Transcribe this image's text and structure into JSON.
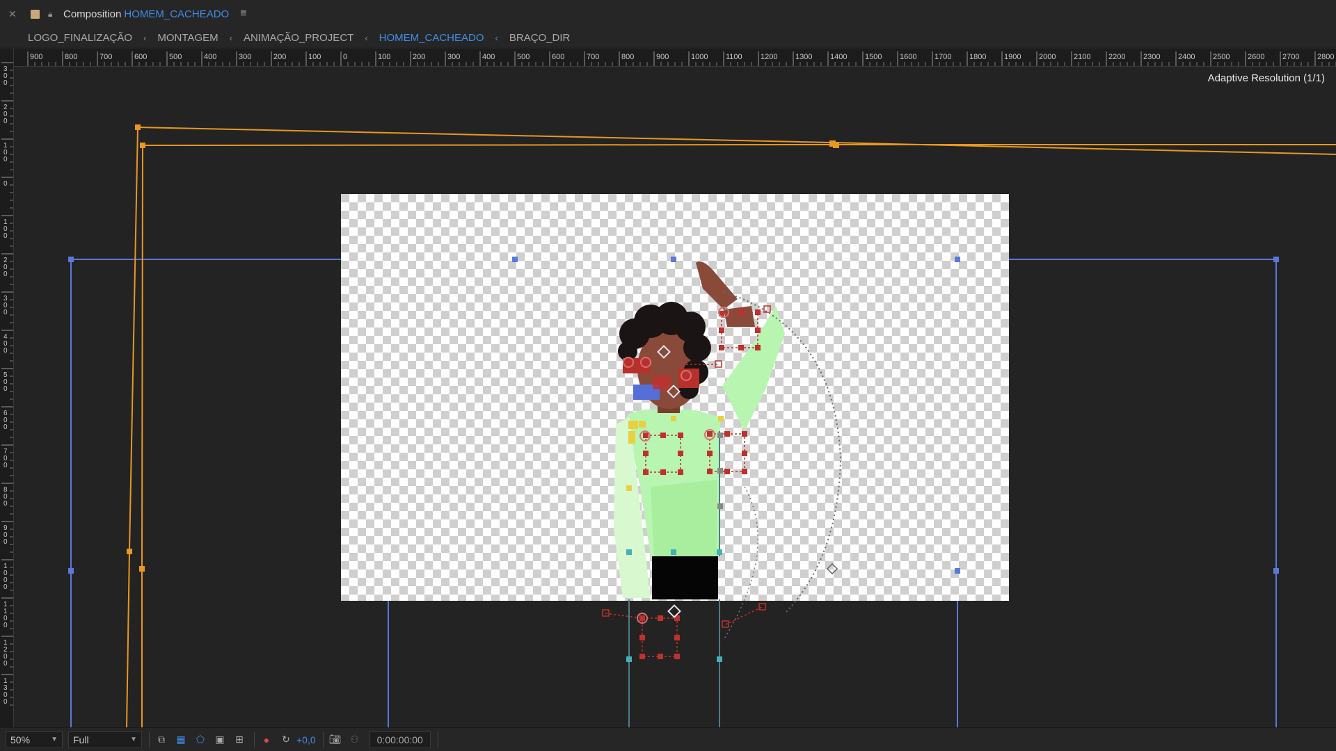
{
  "titlebar": {
    "close_icon": "close-icon",
    "label": "Composition",
    "comp_name": "HOMEM_CACHEADO",
    "menu_icon": "hamburger-menu-icon"
  },
  "breadcrumb": [
    {
      "label": "LOGO_FINALIZAÇÃO",
      "active": false
    },
    {
      "label": "MONTAGEM",
      "active": false
    },
    {
      "label": "ANIMAÇÃO_PROJECT",
      "active": false
    },
    {
      "label": "HOMEM_CACHEADO",
      "active": true
    },
    {
      "label": "BRAÇO_DIR",
      "active": false
    }
  ],
  "ruler": {
    "h_labels": [
      "900",
      "800",
      "700",
      "600",
      "500",
      "400",
      "300",
      "200",
      "100",
      "0",
      "100",
      "200",
      "300",
      "400",
      "500",
      "600",
      "700",
      "800",
      "900",
      "1000",
      "1100",
      "1200",
      "1300",
      "1400",
      "1500",
      "1600",
      "1700",
      "1800",
      "1900",
      "2000",
      "2100",
      "2200",
      "2300",
      "2400",
      "2500",
      "2600",
      "2700",
      "2800"
    ],
    "v_labels": [
      "300",
      "200",
      "100",
      "0",
      "100",
      "200",
      "300",
      "400",
      "500",
      "600",
      "700",
      "800",
      "900",
      "1000",
      "1100",
      "1200",
      "1300"
    ]
  },
  "viewer": {
    "resolution_label": "Adaptive Resolution (1/1)"
  },
  "colors": {
    "accent": "#3f8ee8",
    "motion_path": "#e8981e",
    "layer_bounds": "#5b78d8",
    "keyframe_red": "#c0302c",
    "shirt": "#b7f5b0",
    "skin": "#8a4a3a",
    "hair": "#1a1414"
  },
  "bottombar": {
    "zoom": "50%",
    "resolution": "Full",
    "exposure": "+0,0",
    "timecode": "0:00:00:00"
  }
}
